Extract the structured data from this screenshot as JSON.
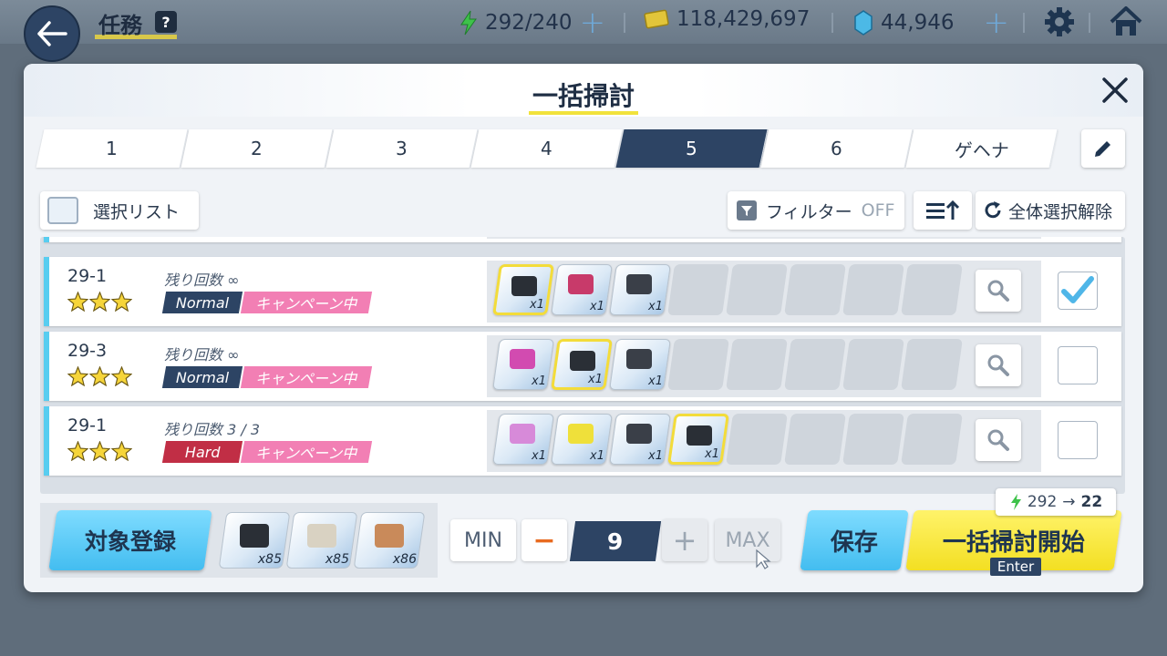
{
  "header": {
    "title": "任務",
    "help_label": "?",
    "ap": "292/240",
    "credits": "118,429,697",
    "pyroxene": "44,946",
    "plus_label": "+"
  },
  "panel": {
    "title": "一括掃討",
    "tabs": [
      {
        "label": "1"
      },
      {
        "label": "2"
      },
      {
        "label": "3"
      },
      {
        "label": "4"
      },
      {
        "label": "5"
      },
      {
        "label": "6"
      },
      {
        "label": "ゲヘナ"
      }
    ],
    "active_tab": 4,
    "select_list_label": "選択リスト",
    "filter_label": "フィルター",
    "filter_state": "OFF",
    "deselect_all_label": "全体選択解除"
  },
  "rows": [
    {
      "stage": "29-1",
      "remaining": "残り回数 ∞",
      "difficulty": "Normal",
      "campaign": "キャンペーン中",
      "stars": 3,
      "checked": true,
      "rewards": [
        {
          "icon": "black-pouch-icon",
          "qty": "x1",
          "highlight": true
        },
        {
          "icon": "headset-icon",
          "qty": "x1",
          "highlight": false
        },
        {
          "icon": "black-shoe-icon",
          "qty": "x1",
          "highlight": false
        }
      ]
    },
    {
      "stage": "29-3",
      "remaining": "残り回数 ∞",
      "difficulty": "Normal",
      "campaign": "キャンペーン中",
      "stars": 3,
      "checked": false,
      "rewards": [
        {
          "icon": "color-cube-icon",
          "qty": "x1",
          "highlight": false
        },
        {
          "icon": "black-pouch-icon",
          "qty": "x1",
          "highlight": true
        },
        {
          "icon": "black-shoe-icon",
          "qty": "x1",
          "highlight": false
        }
      ]
    },
    {
      "stage": "29-1",
      "remaining": "残り回数 3 / 3",
      "difficulty": "Hard",
      "campaign": "キャンペーン中",
      "stars": 3,
      "checked": false,
      "rewards": [
        {
          "icon": "student-eleph-icon",
          "qty": "x1",
          "highlight": false
        },
        {
          "icon": "yellow-orb-icon",
          "qty": "x1",
          "highlight": false
        },
        {
          "icon": "black-shoe-icon",
          "qty": "x1",
          "highlight": false
        },
        {
          "icon": "black-pouch-icon",
          "qty": "x1",
          "highlight": true
        }
      ]
    }
  ],
  "bottom": {
    "register_label": "対象登録",
    "totals": [
      {
        "icon": "black-pouch-icon",
        "qty": "x85"
      },
      {
        "icon": "crumpled-paper-icon",
        "qty": "x85"
      },
      {
        "icon": "bronze-coin-icon",
        "qty": "x86"
      }
    ],
    "min_label": "MIN",
    "minus_label": "−",
    "count": "9",
    "plus_label": "+",
    "max_label": "MAX",
    "save_label": "保存",
    "start_label": "一括掃討開始",
    "enter_label": "Enter",
    "ap_from": "292",
    "ap_to": "22"
  },
  "colors": {
    "navy": "#2d4464",
    "accent_yellow": "#f3df22",
    "accent_blue": "#43bdf0",
    "hard_red": "#c12e45",
    "campaign_pink": "#f27fb4"
  }
}
